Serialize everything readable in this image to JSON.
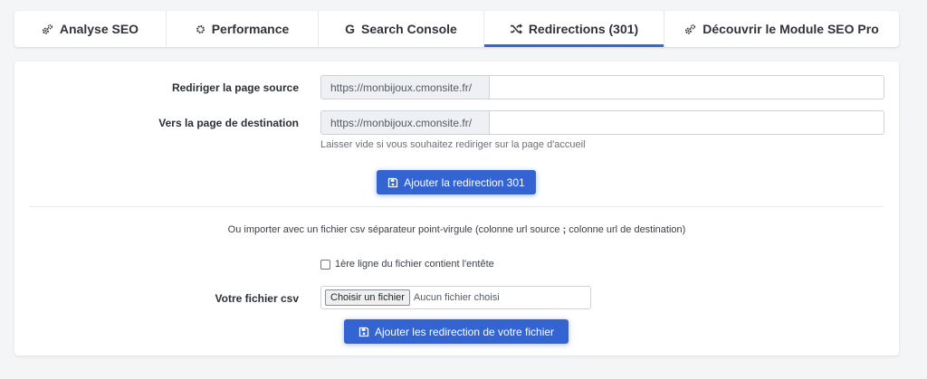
{
  "tabs": [
    {
      "label": "Analyse SEO",
      "icon": "gears-icon"
    },
    {
      "label": "Performance",
      "icon": "gear-icon"
    },
    {
      "label": "Search Console",
      "icon": "google-g-icon"
    },
    {
      "label": "Redirections (301)",
      "icon": "shuffle-icon",
      "active": true
    },
    {
      "label": "Découvrir le Module SEO Pro",
      "icon": "gears-icon"
    }
  ],
  "form": {
    "source_label": "Rediriger la page source",
    "source_prefix": "https://monbijoux.cmonsite.fr/",
    "source_value": "",
    "dest_label": "Vers la page de destination",
    "dest_prefix": "https://monbijoux.cmonsite.fr/",
    "dest_value": "",
    "dest_help": "Laisser vide si vous souhaitez rediriger sur la page d'accueil",
    "add_button": "Ajouter la redirection 301"
  },
  "import": {
    "text_before": "Ou importer avec un fichier csv séparateur point-virgule (colonne url source ",
    "separator": ";",
    "text_after": " colonne url de destination)",
    "header_checkbox_label": "1ère ligne du fichier contient l'entête",
    "header_checked": false,
    "file_label": "Votre fichier csv",
    "file_button": "Choisir un fichier",
    "file_status": "Aucun fichier choisi",
    "submit_button": "Ajouter les redirection de votre fichier"
  },
  "colors": {
    "accent": "#3464d2",
    "active_tab_underline": "#3366d6",
    "background": "#f4f5f7"
  }
}
